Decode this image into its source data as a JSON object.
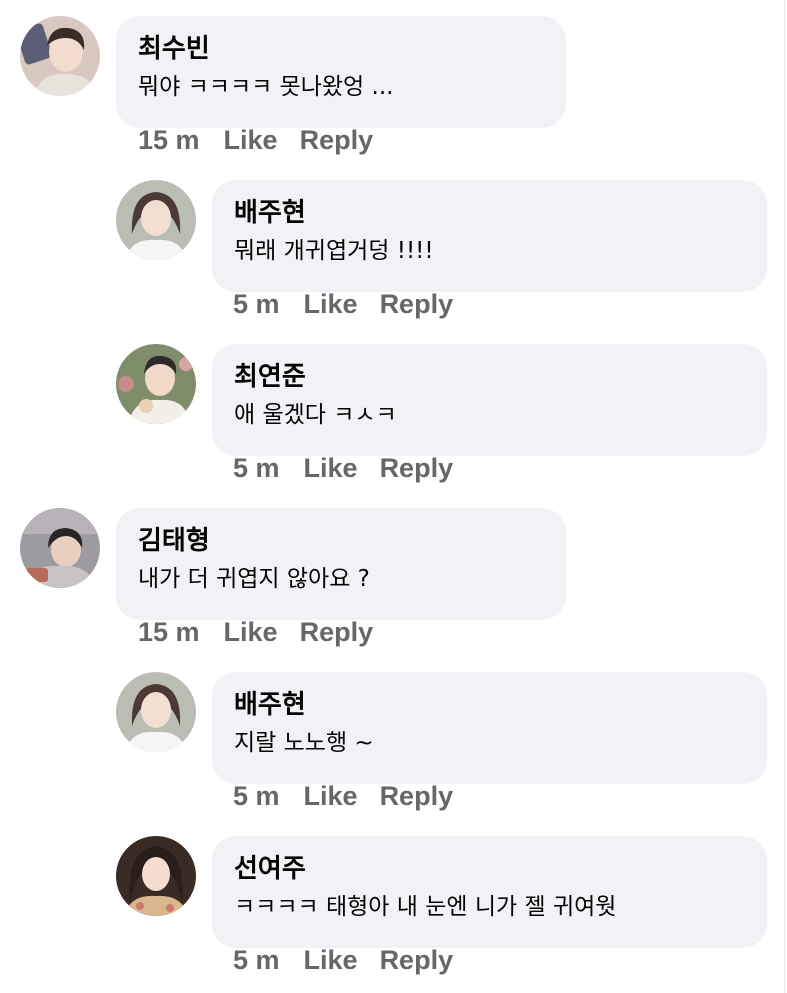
{
  "comments": [
    {
      "author": "최수빈",
      "text": "뭐야 ㅋㅋㅋㅋ 못나왔엉 ...",
      "time": "15 m",
      "like": "Like",
      "reply": "Reply",
      "avatar_colors": {
        "bg": "#d8c8bf",
        "hair": "#3a2d28",
        "skin": "#f1dccd",
        "cloth": "#e9e3de"
      }
    },
    {
      "author": "배주현",
      "text": "뭐래 개귀엽거덩 !!!!",
      "time": "5 m",
      "like": "Like",
      "reply": "Reply",
      "avatar_colors": {
        "bg": "#b9bdb3",
        "hair": "#4a3a33",
        "skin": "#f3ded2",
        "cloth": "#f5f5f5"
      }
    },
    {
      "author": "최연준",
      "text": "애 울겠다 ㅋㅅㅋ",
      "time": "5 m",
      "like": "Like",
      "reply": "Reply",
      "avatar_colors": {
        "bg": "#7f8d6b",
        "hair": "#2e2a2a",
        "skin": "#f0d9c9",
        "cloth": "#f3efe8"
      }
    },
    {
      "author": "김태형",
      "text": "내가 더 귀엽지 않아요 ?",
      "time": "15 m",
      "like": "Like",
      "reply": "Reply",
      "avatar_colors": {
        "bg": "#9d9aa0",
        "hair": "#2b2424",
        "skin": "#e8cfc0",
        "cloth": "#c9c3c8"
      }
    },
    {
      "author": "배주현",
      "text": "지랄 노노행 ~",
      "time": "5 m",
      "like": "Like",
      "reply": "Reply",
      "avatar_colors": {
        "bg": "#b9bdb3",
        "hair": "#4a3a33",
        "skin": "#f3ded2",
        "cloth": "#f5f5f5"
      }
    },
    {
      "author": "선여주",
      "text": "ㅋㅋㅋㅋ 태형아 내 눈엔 니가 젤 귀여웟",
      "time": "5 m",
      "like": "Like",
      "reply": "Reply",
      "avatar_colors": {
        "bg": "#3a2a24",
        "hair": "#2a1e1a",
        "skin": "#f4dcd0",
        "cloth": "#d9b78e"
      }
    }
  ]
}
